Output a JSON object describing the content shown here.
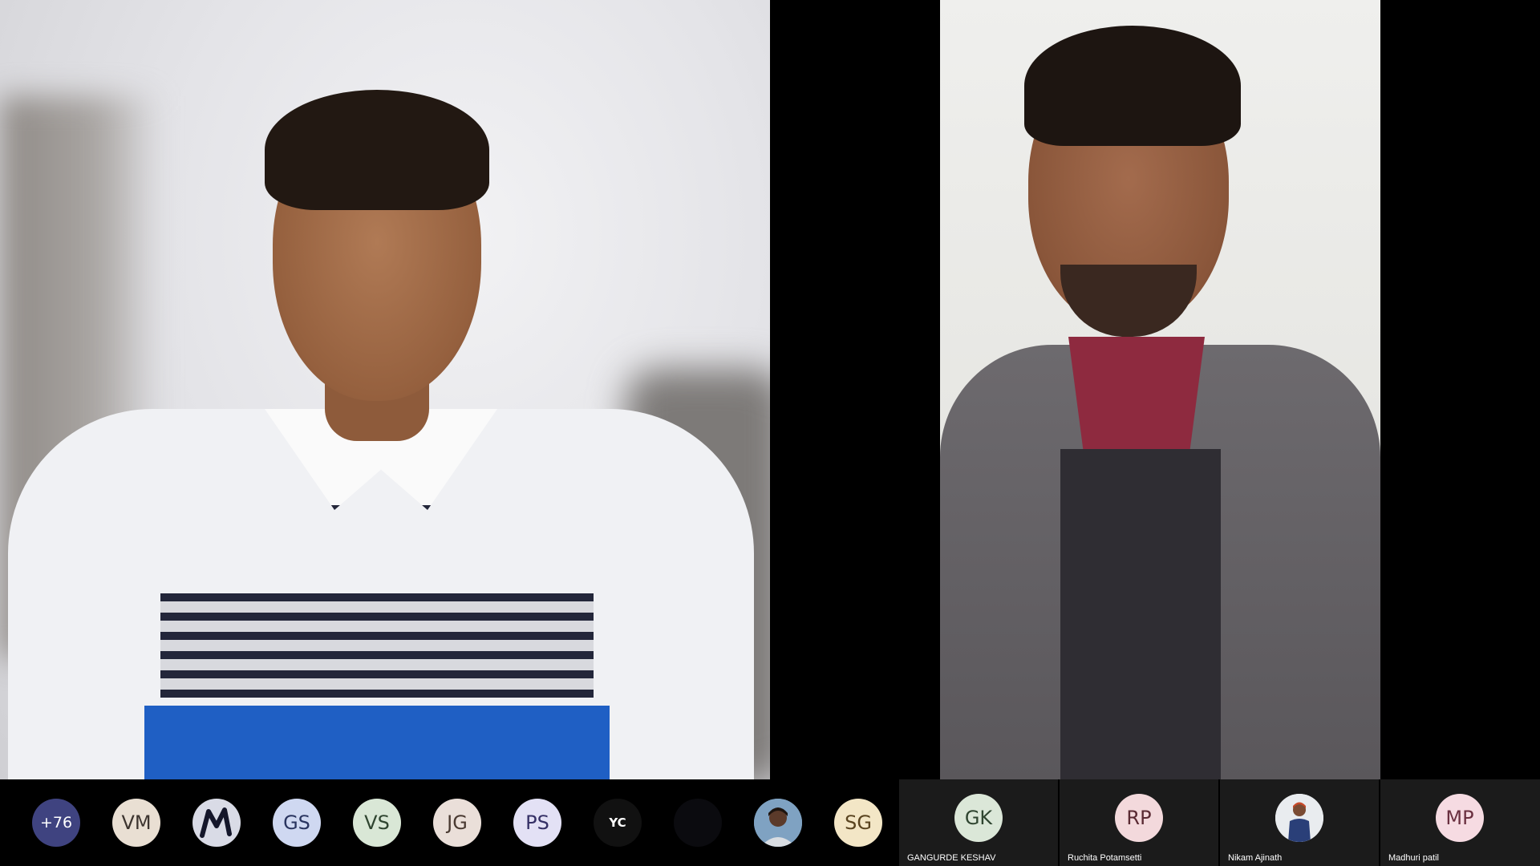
{
  "overflow_count": "+76",
  "strip_avatars": [
    {
      "initials": "VM",
      "bg": "#e9dfd3",
      "color": "#3d3530"
    },
    {
      "icon": "m-logo-icon",
      "bg": "#d9dbe6"
    },
    {
      "initials": "GS",
      "bg": "#cfd8f1",
      "color": "#2a3560"
    },
    {
      "initials": "VS",
      "bg": "#d9e7d6",
      "color": "#2f4530"
    },
    {
      "initials": "JG",
      "bg": "#eadfd9",
      "color": "#4a3a32"
    },
    {
      "initials": "PS",
      "bg": "#e3e1f5",
      "color": "#353066"
    },
    {
      "initials": "YC",
      "bg": "#111111",
      "color": "#ffffff"
    },
    {
      "initials": "",
      "bg": "#0b0b0f"
    },
    {
      "icon": "profile-photo-icon",
      "bg": "#6b8fb0"
    },
    {
      "initials": "SG",
      "bg": "#f3e6c6",
      "color": "#5a4420"
    }
  ],
  "named_tiles": [
    {
      "initials": "GK",
      "name": "GANGURDE KESHAV",
      "bg": "#dbe7d8",
      "color": "#2f4530"
    },
    {
      "initials": "RP",
      "name": "Ruchita Potamsetti",
      "bg": "#f3d9dc",
      "color": "#5a2a33"
    },
    {
      "icon": "profile-photo-icon",
      "name": "Nikam Ajinath",
      "bg": "#e8e8e8"
    },
    {
      "initials": "MP",
      "name": "Madhuri patil",
      "bg": "#f6dbe2",
      "color": "#6a3040"
    }
  ]
}
